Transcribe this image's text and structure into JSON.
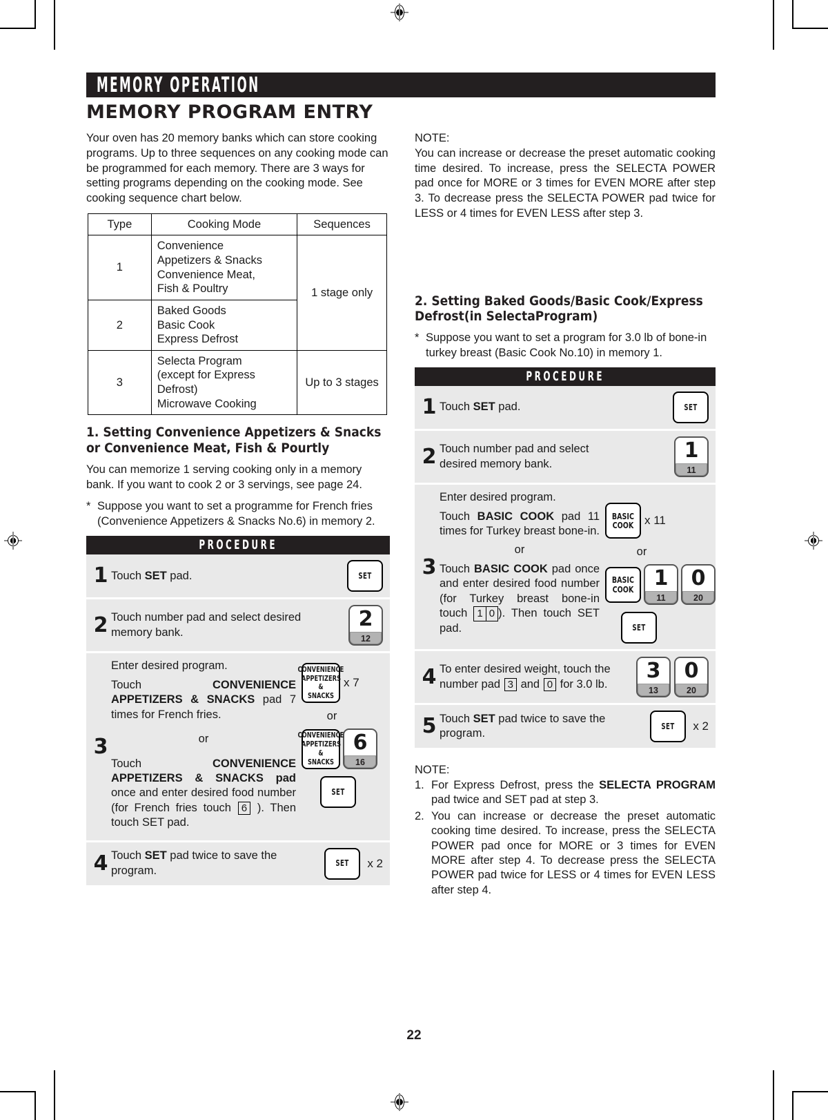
{
  "chapter": {
    "title": "MEMORY OPERATION"
  },
  "section": {
    "title": "MEMORY PROGRAM ENTRY"
  },
  "intro": {
    "paragraph": "Your oven has 20 memory banks which can store cooking programs. Up to three sequences on any cooking mode can be programmed for each memory. There are 3 ways for setting programs depending on the cooking mode. See cooking sequence chart below."
  },
  "chart_table": {
    "headers": [
      "Type",
      "Cooking Mode",
      "Sequences"
    ],
    "rows": [
      {
        "type": "1",
        "mode": "Convenience\nAppetizers & Snacks\nConvenience Meat,\nFish & Poultry",
        "sequence": "1 stage only"
      },
      {
        "type": "2",
        "mode": "Baked Goods\nBasic Cook\nExpress Defrost",
        "sequence": ""
      },
      {
        "type": "3",
        "mode": "Selecta Program\n(except for Express\nDefrost)\nMicrowave Cooking",
        "sequence": "Up to 3 stages"
      }
    ]
  },
  "section1": {
    "heading": "1. Setting Convenience Appetizers & Snacks or Convenience Meat, Fish & Pourtly",
    "paragraph": "You can memorize 1 serving cooking only in a memory bank. If you want to cook 2 or 3 servings, see page 24.",
    "star_marker": "*",
    "star_text": "Suppose you want to set a programme for French fries (Convenience Appetizers & Snacks No.6) in memory 2.",
    "procedure_label": "PROCEDURE",
    "steps": [
      {
        "number": "1",
        "text_before": "Touch ",
        "text_bold": "SET",
        "text_after": " pad.",
        "key_set_label": "SET"
      },
      {
        "number": "2",
        "text": "Touch number pad and select desired memory bank.",
        "numkey_big": "2",
        "numkey_sub": "12"
      },
      {
        "number": "3",
        "lead": "Enter desired program.",
        "option_a_pre": "Touch ",
        "option_a_bold": "CONVENIENCE APPETIZERS & SNACKS",
        "option_a_post": " pad 7 times for French fries.",
        "or": "or",
        "option_b_pre": "Touch ",
        "option_b_bold": "CONVENIENCE APPETIZERS & SNACKS pad",
        "option_b_post_1": " once and enter desired food number (for French fries touch ",
        "option_b_boxed": "6",
        "option_b_post_2": " ). Then touch SET pad.",
        "conv_key": "CONVENIENCE\nAPPETIZERS\n& SNACKS",
        "multiplier": "x 7",
        "numkey_big": "6",
        "numkey_sub": "16",
        "key_set_label": "SET"
      },
      {
        "number": "4",
        "text_before": "Touch ",
        "text_bold": "SET",
        "text_after": " pad twice to save the program.",
        "key_set_label": "SET",
        "multiplier": "x 2"
      }
    ]
  },
  "note_top": {
    "title": "NOTE:",
    "text": "You can increase or decrease the preset automatic cooking time desired. To increase, press the SELECTA POWER pad once for MORE or 3 times for EVEN MORE after step 3. To decrease press the SELECTA POWER pad twice for LESS or 4 times for EVEN LESS after step 3."
  },
  "section2": {
    "heading": "2. Setting Baked Goods/Basic Cook/Express Defrost(in SelectaProgram)",
    "star_marker": "*",
    "star_text": "Suppose you want to set a program for 3.0 lb of bone-in turkey breast (Basic Cook No.10) in memory 1.",
    "procedure_label": "PROCEDURE",
    "steps": [
      {
        "number": "1",
        "text_before": "Touch ",
        "text_bold": "SET",
        "text_after": " pad.",
        "key_set_label": "SET"
      },
      {
        "number": "2",
        "text": "Touch number pad and select desired memory bank.",
        "numkey_big": "1",
        "numkey_sub": "11"
      },
      {
        "number": "3",
        "lead": "Enter desired program.",
        "option_a_pre": "Touch ",
        "option_a_bold": "BASIC COOK",
        "option_a_post": " pad 11 times for Turkey breast bone-in.",
        "or": "or",
        "option_b_pre": "Touch ",
        "option_b_bold": "BASIC COOK",
        "option_b_post_1": " pad once and enter desired food number (for Turkey breast bone-in touch ",
        "option_b_boxed_1": "1",
        "option_b_boxed_2": "0",
        "option_b_post_2": "). Then touch SET pad.",
        "basic_key": "BASIC\nCOOK",
        "multiplier": "x 11",
        "numkey1_big": "1",
        "numkey1_sub": "11",
        "numkey2_big": "0",
        "numkey2_sub": "20",
        "key_set_label": "SET"
      },
      {
        "number": "4",
        "text_pre": "To enter desired weight, touch the number pad ",
        "boxed_1": "3",
        "text_mid": " and ",
        "boxed_2": "0",
        "text_post": "  for 3.0 lb.",
        "numkey1_big": "3",
        "numkey1_sub": "13",
        "numkey2_big": "0",
        "numkey2_sub": "20"
      },
      {
        "number": "5",
        "text_before": "Touch ",
        "text_bold": "SET",
        "text_after": " pad twice to save the program.",
        "key_set_label": "SET",
        "multiplier": "x 2"
      }
    ]
  },
  "note_bottom": {
    "title": "NOTE:",
    "items": [
      {
        "n": "1.",
        "pre": "For Express Defrost, press the ",
        "bold": "SELECTA PROGRAM",
        "post": " pad twice and SET pad at step 3."
      },
      {
        "n": "2.",
        "pre": "You can increase or decrease the preset automatic cooking time desired. To increase, press the SELECTA POWER pad once for MORE or 3 times for EVEN MORE after step 4. To decrease press the SELECTA POWER pad twice for LESS or 4 times for EVEN LESS after step 4.",
        "bold": "",
        "post": ""
      }
    ]
  },
  "footer": {
    "page_number": "22"
  },
  "colors": {
    "bar": "#231f20",
    "panel": "#e9e9e9",
    "key_grey": "#b3b3b3"
  }
}
